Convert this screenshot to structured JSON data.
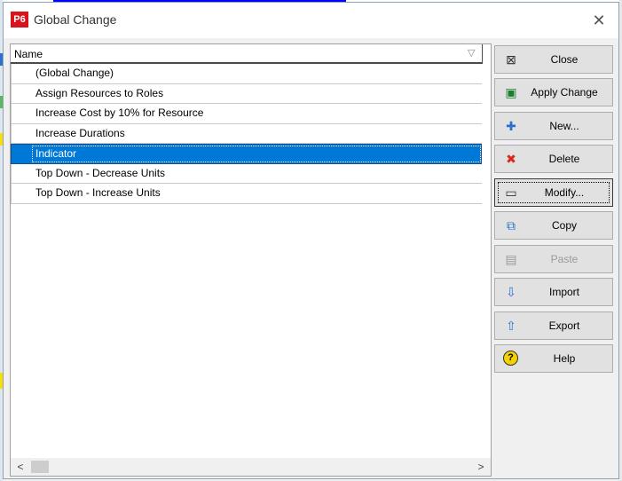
{
  "dialog": {
    "app_icon_text": "P6",
    "title": "Global Change",
    "close_glyph": "✕"
  },
  "list": {
    "header": "Name",
    "filter_icon": "▽",
    "items": [
      {
        "label": "(Global Change)"
      },
      {
        "label": "Assign Resources to Roles"
      },
      {
        "label": "Increase Cost by 10% for Resource"
      },
      {
        "label": "Increase Durations"
      },
      {
        "label": "Indicator"
      },
      {
        "label": "Top Down - Decrease Units"
      },
      {
        "label": "Top Down - Increase Units"
      }
    ],
    "selected_index": 4,
    "scroll_left_glyph": "<",
    "scroll_right_glyph": ">"
  },
  "buttons": [
    {
      "name": "close-button",
      "icon": "close-window-icon",
      "glyph": "⊠",
      "label": "Close",
      "disabled": false
    },
    {
      "name": "apply-change-button",
      "icon": "apply-change-icon",
      "glyph": "▣",
      "label": "Apply Change",
      "disabled": false
    },
    {
      "name": "new-button",
      "icon": "plus-icon",
      "glyph": "✚",
      "label": "New...",
      "disabled": false
    },
    {
      "name": "delete-button",
      "icon": "delete-x-icon",
      "glyph": "✖",
      "label": "Delete",
      "disabled": false
    },
    {
      "name": "modify-button",
      "icon": "modify-icon",
      "glyph": "▭",
      "label": "Modify...",
      "disabled": false,
      "focused": true
    },
    {
      "name": "copy-button",
      "icon": "copy-icon",
      "glyph": "⧉",
      "label": "Copy",
      "disabled": false
    },
    {
      "name": "paste-button",
      "icon": "paste-icon",
      "glyph": "▤",
      "label": "Paste",
      "disabled": true
    },
    {
      "name": "import-button",
      "icon": "import-icon",
      "glyph": "⇩",
      "label": "Import",
      "disabled": false
    },
    {
      "name": "export-button",
      "icon": "export-icon",
      "glyph": "⇧",
      "label": "Export",
      "disabled": false
    },
    {
      "name": "help-button",
      "icon": "help-icon",
      "glyph": "?",
      "label": "Help",
      "disabled": false
    }
  ],
  "colors": {
    "selection": "#0078d7",
    "app_icon": "#d9131b",
    "delete_icon": "#d7281e",
    "help_icon": "#f2d200"
  }
}
